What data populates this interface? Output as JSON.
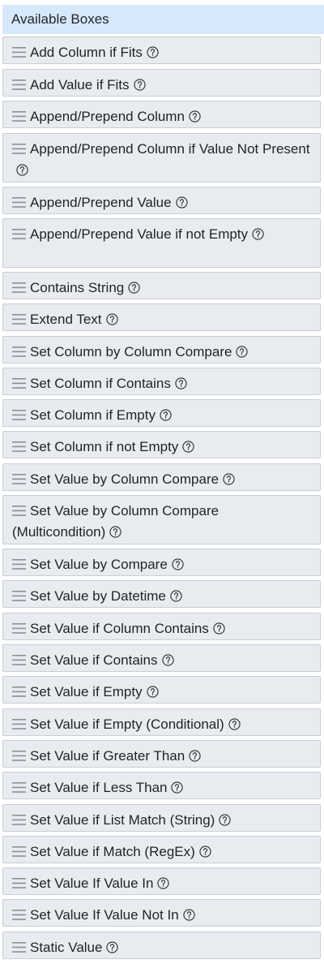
{
  "panel": {
    "title": "Available Boxes",
    "items": [
      {
        "label": "Add Column if Fits"
      },
      {
        "label": "Add Value if Fits"
      },
      {
        "label": "Append/Prepend Column"
      },
      {
        "label": "Append/Prepend Column if Value Not Present"
      },
      {
        "label": "Append/Prepend Value"
      },
      {
        "label": "Append/Prepend Value if not Empty"
      },
      {
        "label": "Contains String"
      },
      {
        "label": "Extend Text"
      },
      {
        "label": "Set Column by Column Compare"
      },
      {
        "label": "Set Column if Contains"
      },
      {
        "label": "Set Column if Empty"
      },
      {
        "label": "Set Column if not Empty"
      },
      {
        "label": "Set Value by Column Compare"
      },
      {
        "label": "Set Value by Column Compare (Multicondition)"
      },
      {
        "label": "Set Value by Compare"
      },
      {
        "label": "Set Value by Datetime"
      },
      {
        "label": "Set Value if Column Contains"
      },
      {
        "label": "Set Value if Contains"
      },
      {
        "label": "Set Value if Empty"
      },
      {
        "label": "Set Value if Empty (Conditional)"
      },
      {
        "label": "Set Value if Greater Than"
      },
      {
        "label": "Set Value if Less Than"
      },
      {
        "label": "Set Value if List Match (String)"
      },
      {
        "label": "Set Value if Match (RegEx)"
      },
      {
        "label": "Set Value If Value In"
      },
      {
        "label": "Set Value If Value Not In"
      },
      {
        "label": "Static Value"
      }
    ]
  },
  "icons": {
    "drag": "drag-handle-icon",
    "help": "question-circle-icon"
  },
  "colors": {
    "header_bg": "#d7e8fb",
    "item_bg": "#e8ebef",
    "item_border": "#c9ced5",
    "text": "#1f2328"
  }
}
